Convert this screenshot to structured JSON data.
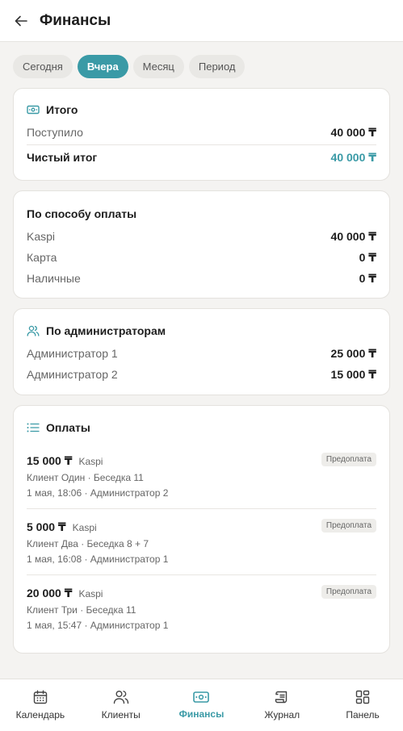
{
  "header": {
    "title": "Финансы"
  },
  "tabs": [
    {
      "label": "Сегодня",
      "active": false
    },
    {
      "label": "Вчера",
      "active": true
    },
    {
      "label": "Месяц",
      "active": false
    },
    {
      "label": "Период",
      "active": false
    }
  ],
  "summary": {
    "title": "Итого",
    "received_label": "Поступило",
    "received_value": "40 000 ₸",
    "net_label": "Чистый итог",
    "net_value": "40 000 ₸"
  },
  "by_method": {
    "title": "По способу оплаты",
    "rows": [
      {
        "label": "Kaspi",
        "value": "40 000 ₸"
      },
      {
        "label": "Карта",
        "value": "0 ₸"
      },
      {
        "label": "Наличные",
        "value": "0 ₸"
      }
    ]
  },
  "by_admin": {
    "title": "По администраторам",
    "rows": [
      {
        "label": "Администратор 1",
        "value": "25 000 ₸"
      },
      {
        "label": "Администратор 2",
        "value": "15 000 ₸"
      }
    ]
  },
  "payments": {
    "title": "Оплаты",
    "items": [
      {
        "amount": "15 000 ₸",
        "method": "Kaspi",
        "client": "Клиент Один · Беседка 11",
        "meta": "1 мая, 18:06 · Администратор 2",
        "badge": "Предоплата"
      },
      {
        "amount": "5 000 ₸",
        "method": "Kaspi",
        "client": "Клиент Два · Беседка 8 + 7",
        "meta": "1 мая, 16:08 · Администратор 1",
        "badge": "Предоплата"
      },
      {
        "amount": "20 000 ₸",
        "method": "Kaspi",
        "client": "Клиент Три · Беседка 11",
        "meta": "1 мая, 15:47 · Администратор 1",
        "badge": "Предоплата"
      }
    ]
  },
  "nav": [
    {
      "label": "Календарь",
      "icon": "calendar-icon",
      "active": false
    },
    {
      "label": "Клиенты",
      "icon": "users-icon",
      "active": false
    },
    {
      "label": "Финансы",
      "icon": "money-icon",
      "active": true
    },
    {
      "label": "Журнал",
      "icon": "scroll-icon",
      "active": false
    },
    {
      "label": "Панель",
      "icon": "grid-icon",
      "active": false
    }
  ],
  "colors": {
    "accent": "#3a9aa6",
    "background": "#f4f3f1"
  }
}
